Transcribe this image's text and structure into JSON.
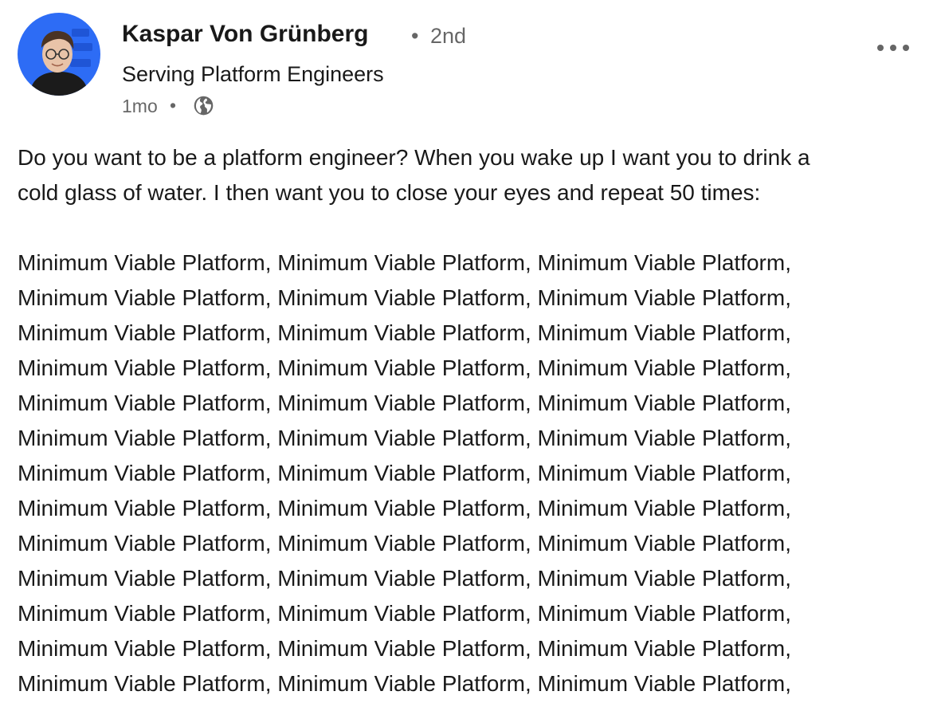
{
  "post": {
    "author": {
      "name": "Kaspar Von Grünberg",
      "degree": "2nd",
      "headline": "Serving Platform Engineers",
      "avatar": "profile-photo"
    },
    "separator": "•",
    "timestamp": "1mo",
    "visibility_icon": "globe-icon",
    "menu_icon": "more-options-icon",
    "body": {
      "intro_lines": [
        "Do you want to be a platform engineer? When you wake up I want you to drink a",
        "cold glass of water. I then want you to close your eyes and repeat 50 times:"
      ],
      "repeat_lines": [
        "Minimum Viable Platform, Minimum Viable Platform, Minimum Viable Platform,",
        "Minimum Viable Platform, Minimum Viable Platform, Minimum Viable Platform,",
        "Minimum Viable Platform, Minimum Viable Platform, Minimum Viable Platform,",
        "Minimum Viable Platform, Minimum Viable Platform, Minimum Viable Platform,",
        "Minimum Viable Platform, Minimum Viable Platform, Minimum Viable Platform,",
        "Minimum Viable Platform, Minimum Viable Platform, Minimum Viable Platform,",
        "Minimum Viable Platform, Minimum Viable Platform, Minimum Viable Platform,",
        "Minimum Viable Platform, Minimum Viable Platform, Minimum Viable Platform,",
        "Minimum Viable Platform, Minimum Viable Platform, Minimum Viable Platform,",
        "Minimum Viable Platform, Minimum Viable Platform, Minimum Viable Platform,",
        "Minimum Viable Platform, Minimum Viable Platform, Minimum Viable Platform,",
        "Minimum Viable Platform, Minimum Viable Platform, Minimum Viable Platform,",
        "Minimum Viable Platform, Minimum Viable Platform, Minimum Viable Platform,"
      ]
    }
  },
  "colors": {
    "avatar_bg": "#2d6cf5",
    "text_primary": "#191919",
    "text_secondary": "#666666"
  }
}
